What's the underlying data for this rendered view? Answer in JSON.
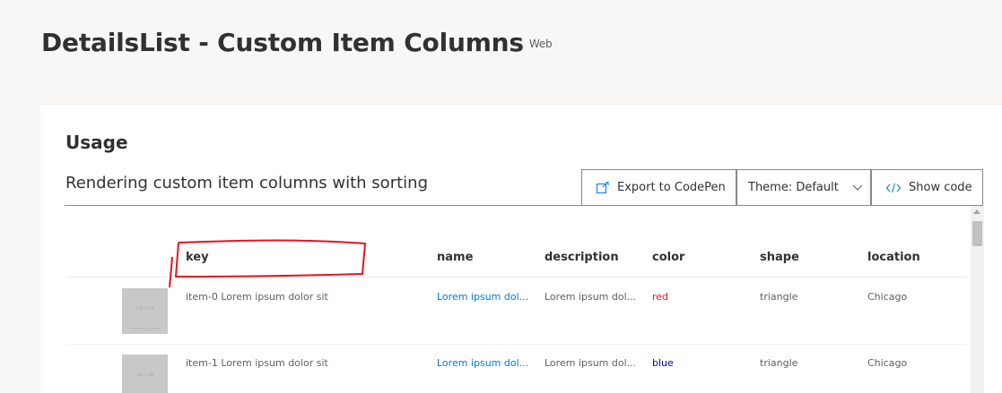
{
  "page": {
    "title": "DetailsList - Custom Item Columns",
    "platform": "Web"
  },
  "section": {
    "heading": "Usage",
    "example_title": "Rendering custom item columns with sorting"
  },
  "toolbar": {
    "export_label": "Export to CodePen",
    "theme_label": "Theme: Default",
    "code_label": "Show code"
  },
  "columns": [
    "key",
    "name",
    "description",
    "color",
    "shape",
    "location"
  ],
  "rows": [
    {
      "key": "item-0 Lorem ipsum dolor sit",
      "name": "Lorem ipsum dol...",
      "description": "Lorem ipsum dol...",
      "color": "red",
      "shape": "triangle",
      "location": "Chicago"
    },
    {
      "key": "item-1 Lorem ipsum dolor sit",
      "name": "Lorem ipsum dol...",
      "description": "Lorem ipsum dol...",
      "color": "blue",
      "shape": "triangle",
      "location": "Chicago"
    }
  ],
  "icons": {
    "export": "external-link-icon",
    "theme": "chevron-down-icon",
    "code": "code-icon"
  },
  "colors": {
    "accent": "#0078d4",
    "annotation": "#e81123",
    "color_red": "#e81123",
    "color_blue": "#0000cc"
  }
}
